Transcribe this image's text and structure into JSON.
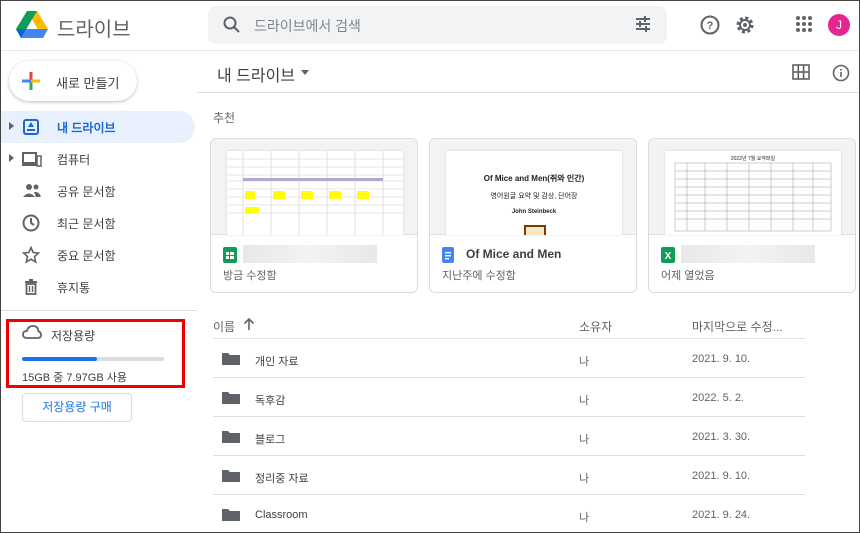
{
  "app": {
    "name": "드라이브"
  },
  "search": {
    "placeholder": "드라이브에서 검색"
  },
  "avatar_initial": "J",
  "sidebar": {
    "new_label": "새로 만들기",
    "items": [
      {
        "label": "내 드라이브",
        "icon": "my-drive-icon",
        "active": true
      },
      {
        "label": "컴퓨터",
        "icon": "computer-icon"
      },
      {
        "label": "공유 문서함",
        "icon": "shared-icon"
      },
      {
        "label": "최근 문서함",
        "icon": "clock-icon"
      },
      {
        "label": "중요 문서함",
        "icon": "star-icon"
      },
      {
        "label": "휴지통",
        "icon": "trash-icon"
      }
    ],
    "storage": {
      "label": "저장용량",
      "used_text": "15GB 중 7.97GB 사용",
      "used_fraction": 0.53,
      "buy_label": "저장용량 구매"
    }
  },
  "main": {
    "title": "내 드라이브",
    "suggested_label": "추천",
    "cards": [
      {
        "name": "",
        "subtitle": "방금 수정함",
        "icon": "sheets-icon"
      },
      {
        "name": "Of Mice and Men",
        "subtitle": "지난주에 수정함",
        "icon": "docs-icon",
        "preview": {
          "title": "Of Mice and Men(쥐와 인간)",
          "line1": "영어원글 요약 및 감상, 단어장",
          "author": "John Steinbeck"
        }
      },
      {
        "name": "",
        "subtitle": "어제 열었음",
        "icon": "excel-icon",
        "preview": {
          "title": "2022년 7월 요약파일"
        }
      }
    ],
    "list": {
      "headers": {
        "name": "이름",
        "owner": "소유자",
        "modified": "마지막으로 수정..."
      },
      "rows": [
        {
          "name": "개인 자료",
          "owner": "나",
          "modified": "2021. 9. 10."
        },
        {
          "name": "독후감",
          "owner": "나",
          "modified": "2022. 5. 2."
        },
        {
          "name": "블로그",
          "owner": "나",
          "modified": "2021. 3. 30."
        },
        {
          "name": "정리중 자료",
          "owner": "나",
          "modified": "2021. 9. 10."
        },
        {
          "name": "Classroom",
          "owner": "나",
          "modified": "2021. 9. 24."
        }
      ]
    }
  },
  "colors": {
    "accent": "#1a73e8",
    "active_bg": "#e8f0fe",
    "highlight_box": "#e00000",
    "avatar": "#e52592"
  }
}
